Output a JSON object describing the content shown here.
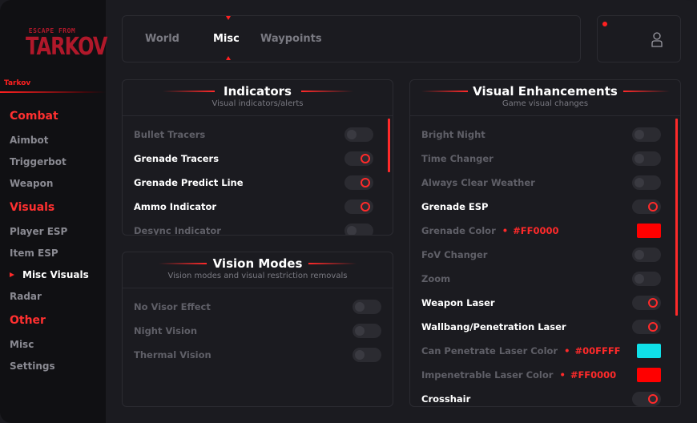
{
  "sidebar": {
    "logo_top": "ESCAPE FROM",
    "logo_main": "TARKOV",
    "brand": "Tarkov",
    "sections": [
      {
        "label": "Combat",
        "items": [
          "Aimbot",
          "Triggerbot",
          "Weapon"
        ]
      },
      {
        "label": "Visuals",
        "items": [
          "Player ESP",
          "Item ESP",
          "Misc Visuals",
          "Radar"
        ]
      },
      {
        "label": "Other",
        "items": [
          "Misc",
          "Settings"
        ]
      }
    ],
    "active_item": "Misc Visuals"
  },
  "tabs": {
    "items": [
      "World",
      "Misc",
      "Waypoints"
    ],
    "active": "Misc"
  },
  "indicators": {
    "title": "Indicators",
    "subtitle": "Visual indicators/alerts",
    "rows": [
      {
        "label": "Bullet Tracers",
        "on": false
      },
      {
        "label": "Grenade Tracers",
        "on": true
      },
      {
        "label": "Grenade Predict Line",
        "on": true
      },
      {
        "label": "Ammo Indicator",
        "on": true
      },
      {
        "label": "Desync Indicator",
        "on": false
      }
    ]
  },
  "vision": {
    "title": "Vision Modes",
    "subtitle": "Vision modes and visual restriction removals",
    "rows": [
      {
        "label": "No Visor Effect",
        "on": false
      },
      {
        "label": "Night Vision",
        "on": false
      },
      {
        "label": "Thermal Vision",
        "on": false
      }
    ]
  },
  "enhancements": {
    "title": "Visual Enhancements",
    "subtitle": "Game visual changes",
    "rows": [
      {
        "label": "Bright Night",
        "on": false
      },
      {
        "label": "Time Changer",
        "on": false
      },
      {
        "label": "Always Clear Weather",
        "on": false
      },
      {
        "label": "Grenade ESP",
        "on": true
      },
      {
        "label": "Grenade Color",
        "color": "#FF0000",
        "hex": "#FF0000"
      },
      {
        "label": "FoV Changer",
        "on": false
      },
      {
        "label": "Zoom",
        "on": false
      },
      {
        "label": "Weapon Laser",
        "on": true
      },
      {
        "label": "Wallbang/Penetration Laser",
        "on": true
      },
      {
        "label": "Can Penetrate Laser Color",
        "color": "#00FFFF",
        "hex": "#00FFFF"
      },
      {
        "label": "Impenetrable Laser Color",
        "color": "#FF0000",
        "hex": "#FF0000"
      },
      {
        "label": "Crosshair",
        "on": true
      }
    ]
  },
  "colors": {
    "accent": "#ff2a2a",
    "background": "#1b1b20",
    "sidebar": "#101013"
  }
}
